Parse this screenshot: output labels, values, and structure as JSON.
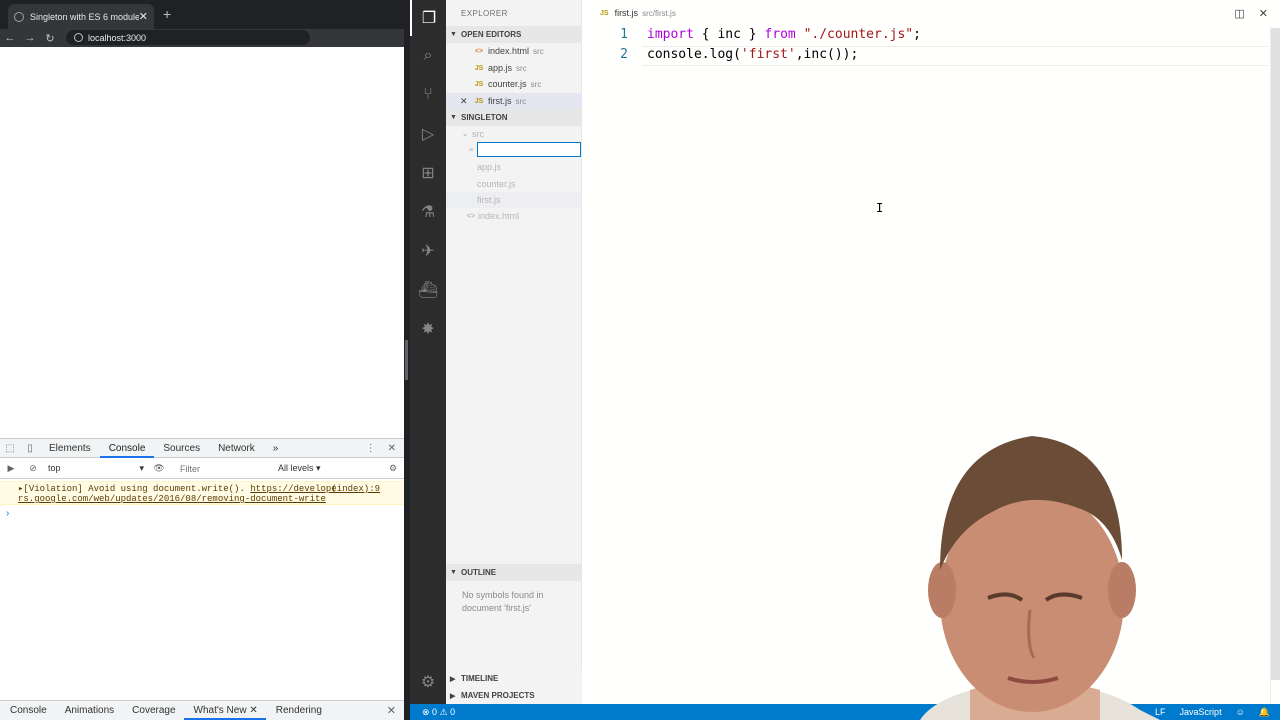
{
  "browser": {
    "tab_title": "Singleton with ES 6 modules",
    "tab_close": "✕",
    "new_tab": "+",
    "url": "localhost:3000"
  },
  "devtools": {
    "tabs": [
      "Elements",
      "Console",
      "Sources",
      "Network"
    ],
    "more_tabs": "»",
    "context": "top",
    "filter_placeholder": "Filter",
    "levels": "All levels ▾",
    "violation_prefix": "▸[Violation] Avoid using document.write(). ",
    "violation_link": "https://develope",
    "violation_link2": "rs.google.com/web/updates/2016/08/removing-document-write",
    "violation_source": "(index):9",
    "prompt": "›",
    "drawer_tabs": [
      "Console",
      "Animations",
      "Coverage",
      "What's New",
      "Rendering"
    ],
    "drawer_close": "✕"
  },
  "vscode": {
    "explorer_title": "EXPLORER",
    "open_editors_title": "OPEN EDITORS",
    "open_editors": [
      {
        "icon": "<>",
        "name": "index.html",
        "desc": "src"
      },
      {
        "icon": "JS",
        "name": "app.js",
        "desc": "src"
      },
      {
        "icon": "JS",
        "name": "counter.js",
        "desc": "src"
      },
      {
        "icon": "JS",
        "name": "first.js",
        "desc": "src"
      }
    ],
    "project_title": "SINGLETON",
    "tree": {
      "folder": "src",
      "files": [
        "app.js",
        "counter.js",
        "first.js",
        "index.html"
      ]
    },
    "outline_title": "OUTLINE",
    "outline_msg": "No symbols found in document 'first.js'",
    "timeline_title": "TIMELINE",
    "maven_title": "MAVEN PROJECTS",
    "editor_tab": {
      "icon": "JS",
      "name": "first.js",
      "path": "src/first.js"
    },
    "code": {
      "line1": {
        "num": "1",
        "kw": "import",
        "p1": " { inc } ",
        "from": "from",
        "p2": " ",
        "str": "\"./counter.js\"",
        "end": ";"
      },
      "line2": {
        "num": "2",
        "a": "console.log(",
        "str": "'first'",
        "b": ",inc());"
      }
    },
    "status": {
      "problems": "⊗ 0 ⚠ 0",
      "eol": "LF",
      "language": "JavaScript"
    }
  },
  "colors": {
    "accent": "#007acc",
    "activity_bar": "#2c2c2c",
    "chrome_dark": "#202124"
  }
}
